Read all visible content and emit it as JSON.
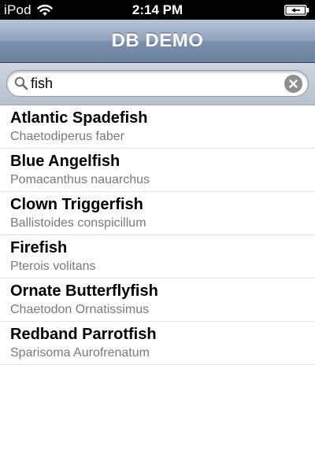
{
  "status_bar": {
    "carrier": "iPod",
    "time": "2:14 PM",
    "icons": {
      "wifi": "wifi-icon",
      "battery": "battery-icon"
    }
  },
  "nav_bar": {
    "title": "DB DEMO"
  },
  "search": {
    "value": "fish",
    "icon": "search-icon",
    "clear_icon": "clear-icon"
  },
  "results": [
    {
      "name": "Atlantic Spadefish",
      "scientific": "Chaetodiperus faber"
    },
    {
      "name": "Blue Angelfish",
      "scientific": "Pomacanthus nauarchus"
    },
    {
      "name": "Clown Triggerfish",
      "scientific": "Ballistoides conspicillum"
    },
    {
      "name": "Firefish",
      "scientific": "Pterois volitans"
    },
    {
      "name": "Ornate Butterflyfish",
      "scientific": "Chaetodon Ornatissimus"
    },
    {
      "name": "Redband Parrotfish",
      "scientific": "Sparisoma Aurofrenatum"
    }
  ],
  "colors": {
    "nav_bar_top": "#b9c6d7",
    "nav_bar_bottom": "#6d83a2",
    "title_text": "#ffffff",
    "subtitle_text": "#7a7a7a",
    "separator": "#e0e0e0"
  }
}
